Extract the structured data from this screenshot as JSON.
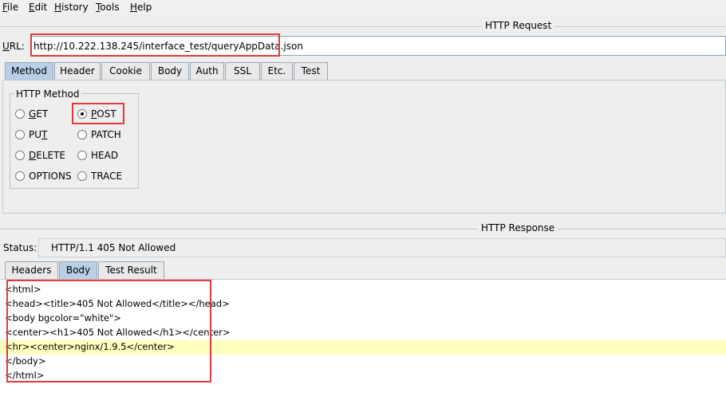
{
  "menubar": {
    "items": [
      {
        "mnemonic": "F",
        "rest": "ile"
      },
      {
        "mnemonic": "E",
        "rest": "dit"
      },
      {
        "mnemonic": "H",
        "rest": "istory"
      },
      {
        "mnemonic": "T",
        "rest": "ools"
      },
      {
        "mnemonic": "H",
        "rest": "elp"
      }
    ]
  },
  "request": {
    "section_title": "HTTP Request",
    "url_label_mn": "U",
    "url_label_rest": "RL:",
    "url": "http://10.222.138.245/interface_test/queryAppData.json",
    "tabs": [
      "Method",
      "Header",
      "Cookie",
      "Body",
      "Auth",
      "SSL",
      "Etc.",
      "Test"
    ],
    "active_tab": "Method",
    "method_group_title": "HTTP Method",
    "methods": [
      {
        "pre": "",
        "mn": "G",
        "post": "ET"
      },
      {
        "pre": "",
        "mn": "P",
        "post": "OST"
      },
      {
        "pre": "PU",
        "mn": "T",
        "post": ""
      },
      {
        "pre": "PATCH",
        "mn": "",
        "post": ""
      },
      {
        "pre": "",
        "mn": "D",
        "post": "ELETE"
      },
      {
        "pre": "HEAD",
        "mn": "",
        "post": ""
      },
      {
        "pre": "OPTIONS",
        "mn": "",
        "post": ""
      },
      {
        "pre": "TRACE",
        "mn": "",
        "post": ""
      }
    ],
    "selected_method": "POST"
  },
  "response": {
    "section_title": "HTTP Response",
    "status_label": "Status:",
    "status_value": "HTTP/1.1 405 Not Allowed",
    "tabs": [
      "Headers",
      "Body",
      "Test Result"
    ],
    "active_tab": "Body",
    "body_lines": [
      "<html>",
      "<head><title>405 Not Allowed</title></head>",
      "<body bgcolor=\"white\">",
      "<center><h1>405 Not Allowed</h1></center>",
      "<hr><center>nginx/1.9.5</center>",
      "</body>",
      "</html>"
    ]
  },
  "colors": {
    "active_tab": "#b8cfe5",
    "highlight_row": "#ffffc0",
    "annotation_box": "#e03c3c"
  }
}
